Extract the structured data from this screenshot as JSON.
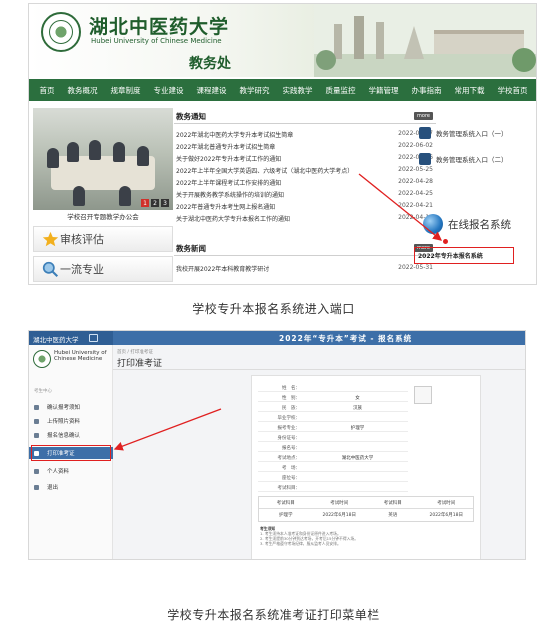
{
  "shot1": {
    "university_cn": "湖北中医药大学",
    "university_en": "Hubei University of Chinese Medicine",
    "department": "教务处",
    "nav": [
      "首页",
      "教务概况",
      "规章制度",
      "专业建设",
      "课程建设",
      "教学研究",
      "实践教学",
      "质量监控",
      "学籍管理",
      "办事指南",
      "常用下载",
      "学校首页"
    ],
    "photo_caption": "学校召开专题教学办公会",
    "pager": [
      "1",
      "2",
      "3"
    ],
    "side_buttons": [
      "审核评估",
      "一流专业"
    ],
    "notices_title": "教务通知",
    "more_label": "more",
    "notices": [
      {
        "title": "2022年湖北中医药大学专升本考试招生简章",
        "date": "2022-06-07"
      },
      {
        "title": "2022年湖北普通专升本考试招生简章",
        "date": "2022-06-02"
      },
      {
        "title": "关于做好2022年专升本考试工作的通知",
        "date": "2022-05-26"
      },
      {
        "title": "2022年上半年全国大学英语四、六级考试（湖北中医药大学考点）",
        "date": "2022-05-25"
      },
      {
        "title": "2022年上半年课程考试工作安排的通知",
        "date": "2022-04-28"
      },
      {
        "title": "关于开展教务教学系统操作的培训的通知",
        "date": "2022-04-25"
      },
      {
        "title": "2022年普通专升本考生网上报名通知",
        "date": "2022-04-21"
      },
      {
        "title": "关于湖北中医药大学专升本报名工作的通知",
        "date": "2022-04-19"
      }
    ],
    "news_title": "教务新闻",
    "news": [
      {
        "title": "我校开展2022年本科教育教学研讨",
        "date": "2022-05-31"
      }
    ],
    "right_links": [
      "教务管理系统入口（一）",
      "教务管理系统入口（二）"
    ],
    "online_reg_label": "在线报名系统",
    "reg_link_label": "2022年专升本报名系统",
    "caption": "学校专升本报名系统进入端口"
  },
  "shot2": {
    "brand": "湖北中医药大学",
    "top_title": "2022年“专升本”考试 - 报名系统",
    "logo_text": "Hubei University of Chinese Medicine",
    "side_small": "考生中心",
    "menu": [
      "确认报考须知",
      "上传照片资料",
      "报名信息确认",
      "打印准考证",
      "个人资料",
      "退出"
    ],
    "breadcrumb": "首页 / 打印准考证",
    "page_title": "打印准考证",
    "ticket_rows": [
      {
        "k": "姓　名：",
        "v": ""
      },
      {
        "k": "性　别：",
        "v": "女"
      },
      {
        "k": "民　族：",
        "v": "汉族"
      },
      {
        "k": "毕业学校：",
        "v": ""
      },
      {
        "k": "报考专业：",
        "v": "护理学"
      },
      {
        "k": "身份证号：",
        "v": ""
      },
      {
        "k": "报名号：",
        "v": ""
      },
      {
        "k": "考试地点：",
        "v": "湖北中医药大学"
      },
      {
        "k": "考　场：",
        "v": ""
      },
      {
        "k": "座位号：",
        "v": ""
      },
      {
        "k": "考试科目：",
        "v": ""
      }
    ],
    "exam_table": [
      [
        "考试科目",
        "考试时间",
        "考试科目",
        "考试时间"
      ],
      [
        "护理学",
        "2022年6月18日",
        "英语",
        "2022年6月18日"
      ]
    ],
    "notes_title": "考生须知",
    "notes": [
      "1. 考生须持本人准考证和身份证原件进入考场。",
      "2. 考生须提前30分钟到达考场，开考后15分钟不得入场。",
      "3. 考生严格遵守考场纪律，服从监考人员安排。"
    ],
    "caption": "学校专升本报名系统准考证打印菜单栏"
  },
  "colors": {
    "brand_green": "#2b6f3e",
    "system_blue": "#3d6fa8",
    "highlight_red": "#e02020"
  }
}
